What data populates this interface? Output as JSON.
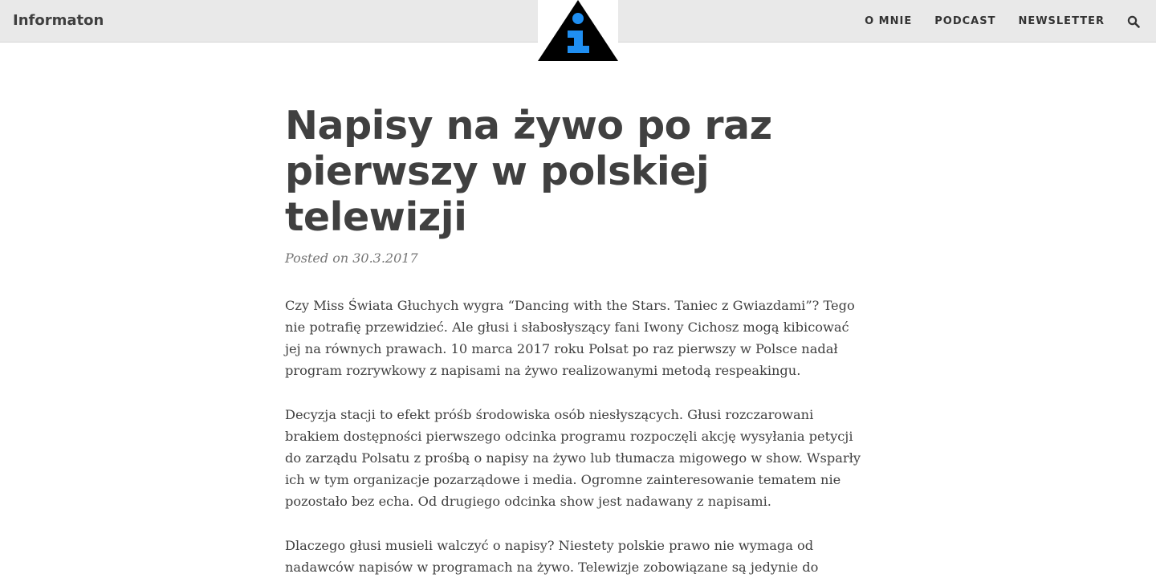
{
  "header": {
    "site_title": "Informaton",
    "nav": [
      "O MNIE",
      "PODCAST",
      "NEWSLETTER"
    ],
    "logo_letter": "i",
    "accent_color": "#1f8ef1"
  },
  "post": {
    "title_lines": [
      "Napisy na żywo po raz",
      "pierwszy w polskiej",
      "telewizji"
    ],
    "meta_prefix": "Posted on",
    "date": "30.3.2017",
    "paragraphs": [
      [
        "Czy Miss Świata Głuchych wygra “Dancing with the Stars. Taniec z Gwiazdami”? Tego",
        "nie potrafię przewidzieć. Ale głusi i słabosłyszący fani Iwony Cichosz mogą kibicować",
        "jej na równych prawach. 10 marca 2017 roku Polsat po raz pierwszy w Polsce nadał",
        "program rozrywkowy z napisami na żywo realizowanymi metodą respeakingu."
      ],
      [
        "Decyzja stacji to efekt próśb środowiska osób niesłyszących. Głusi rozczarowani",
        "brakiem dostępności pierwszego odcinka programu rozpoczęli akcję wysyłania petycji",
        "do zarządu Polsatu z prośbą o napisy na żywo lub tłumacza migowego w show. Wsparły",
        "ich w tym organizacje pozarządowe i media. Ogromne zainteresowanie tematem nie",
        "pozostało bez echa. Od drugiego odcinka show jest nadawany z napisami."
      ],
      [
        "Dlaczego głusi musieli walczyć o napisy? Niestety polskie prawo nie wymaga od",
        "nadawców napisów w programach na żywo. Telewizje zobowiązane są jedynie do"
      ]
    ]
  }
}
